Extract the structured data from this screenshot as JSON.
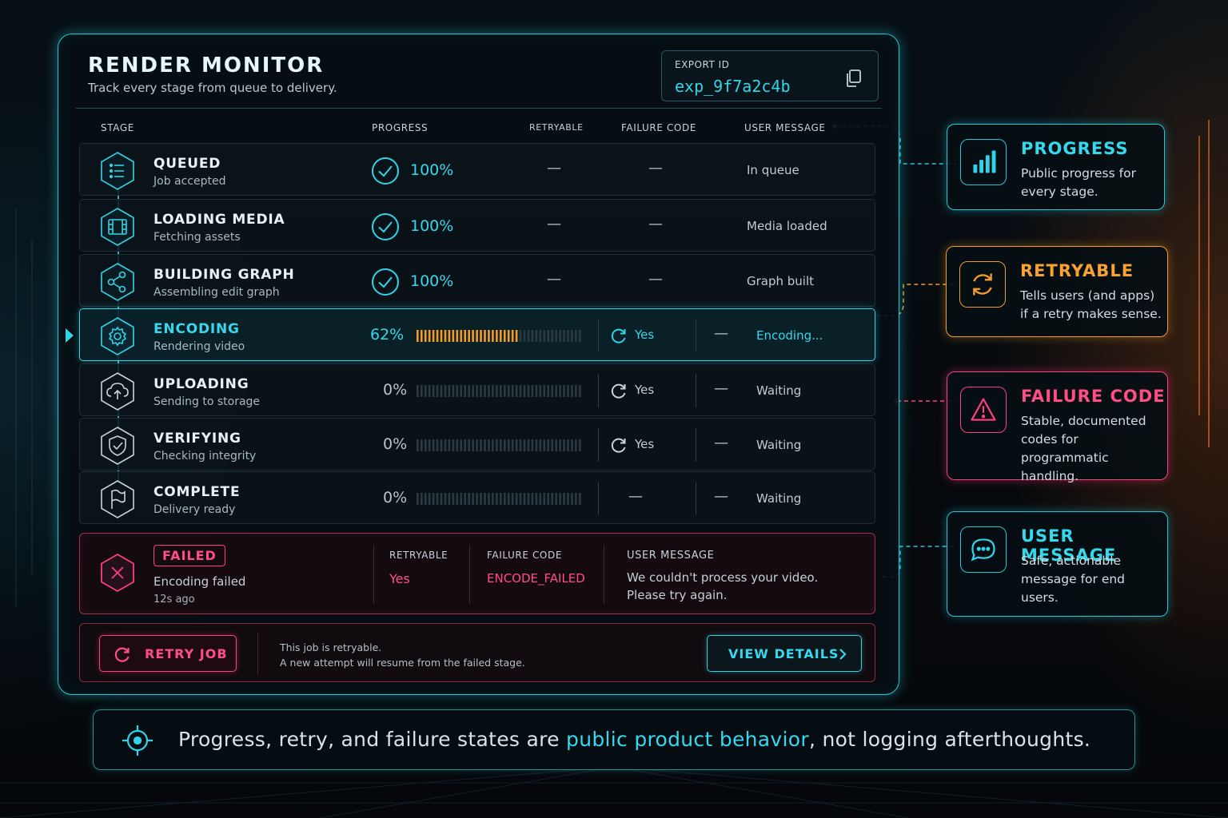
{
  "header": {
    "title": "RENDER MONITOR",
    "subtitle": "Track every stage from queue to delivery.",
    "export_label": "EXPORT ID",
    "export_id": "exp_9f7a2c4b"
  },
  "columns": {
    "stage": "STAGE",
    "progress": "PROGRESS",
    "retryable": "RETRYABLE",
    "failure_code": "FAILURE CODE",
    "user_message": "USER MESSAGE"
  },
  "stages": [
    {
      "name": "QUEUED",
      "desc": "Job accepted",
      "progress_label": "100%",
      "progress": 100,
      "retryable": "—",
      "failure_code": "—",
      "message": "In queue",
      "icon": "list-icon"
    },
    {
      "name": "LOADING MEDIA",
      "desc": "Fetching assets",
      "progress_label": "100%",
      "progress": 100,
      "retryable": "—",
      "failure_code": "—",
      "message": "Media loaded",
      "icon": "film-icon"
    },
    {
      "name": "BUILDING GRAPH",
      "desc": "Assembling edit graph",
      "progress_label": "100%",
      "progress": 100,
      "retryable": "—",
      "failure_code": "—",
      "message": "Graph built",
      "icon": "graph-icon"
    },
    {
      "name": "ENCODING",
      "desc": "Rendering video",
      "progress_label": "62%",
      "progress": 62,
      "retryable": "Yes",
      "failure_code": "—",
      "message": "Encoding...",
      "icon": "gear-icon"
    },
    {
      "name": "UPLOADING",
      "desc": "Sending to storage",
      "progress_label": "0%",
      "progress": 0,
      "retryable": "Yes",
      "failure_code": "—",
      "message": "Waiting",
      "icon": "cloud-upload-icon"
    },
    {
      "name": "VERIFYING",
      "desc": "Checking integrity",
      "progress_label": "0%",
      "progress": 0,
      "retryable": "Yes",
      "failure_code": "—",
      "message": "Waiting",
      "icon": "shield-check-icon"
    },
    {
      "name": "COMPLETE",
      "desc": "Delivery ready",
      "progress_label": "0%",
      "progress": 0,
      "retryable": "—",
      "failure_code": "—",
      "message": "Waiting",
      "icon": "flag-icon"
    }
  ],
  "failure": {
    "badge": "FAILED",
    "desc": "Encoding failed",
    "time": "12s ago",
    "retryable_label": "RETRYABLE",
    "retryable_value": "Yes",
    "code_label": "FAILURE CODE",
    "code_value": "ENCODE_FAILED",
    "message_label": "USER MESSAGE",
    "message_line1": "We couldn't process your video.",
    "message_line2": "Please try again."
  },
  "actions": {
    "retry_label": "RETRY JOB",
    "note_line1": "This job is retryable.",
    "note_line2": "A new attempt will resume from the failed stage.",
    "details_label": "VIEW DETAILS"
  },
  "callouts": {
    "progress": {
      "title": "PROGRESS",
      "text": "Public progress for every stage."
    },
    "retryable": {
      "title": "RETRYABLE",
      "text": "Tells users (and apps) if a retry makes sense."
    },
    "failure_code": {
      "title": "FAILURE CODE",
      "text": "Stable, documented codes for programmatic handling."
    },
    "user_message": {
      "title": "USER MESSAGE",
      "text": "Safe, actionable message for end users."
    }
  },
  "banner": {
    "before": "Progress, retry, and failure states are ",
    "highlight": "public product behavior",
    "after": ", not logging afterthoughts."
  },
  "colors": {
    "accent": "#35d8ec",
    "warning": "#f39a28",
    "danger": "#ff3d7f",
    "bar_fill": "#f39a28"
  }
}
